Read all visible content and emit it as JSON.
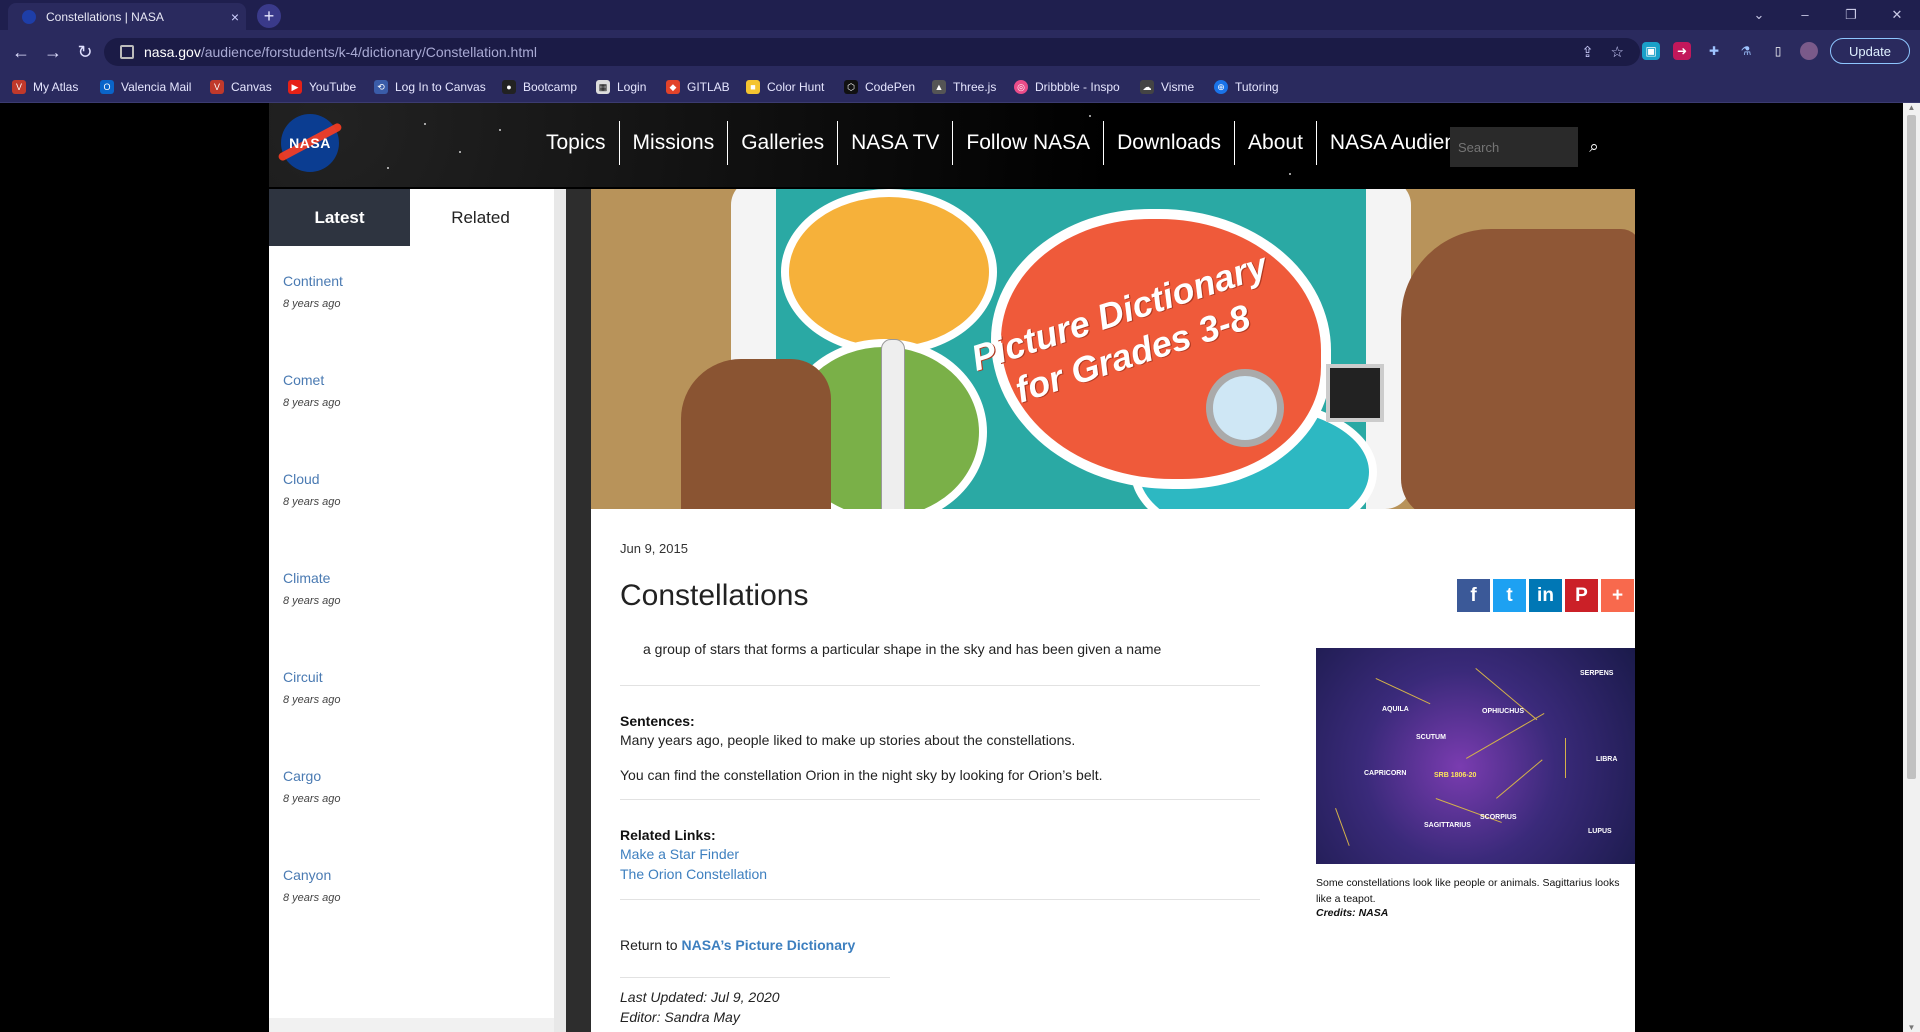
{
  "browser": {
    "tab_title": "Constellations | NASA",
    "tab_close": "×",
    "new_tab": "+",
    "url_host": "nasa.gov",
    "url_path": "/audience/forstudents/k-4/dictionary/Constellation.html",
    "update_label": "Update",
    "bookmarks": [
      {
        "label": "My Atlas",
        "icon": "atlas-icon",
        "color": "#c0392b"
      },
      {
        "label": "Valencia Mail",
        "icon": "outlook-icon",
        "color": "#0a64c9"
      },
      {
        "label": "Canvas",
        "icon": "canvas-icon",
        "color": "#c0392b"
      },
      {
        "label": "YouTube",
        "icon": "youtube-icon",
        "color": "#e62117"
      },
      {
        "label": "Log In to Canvas",
        "icon": "canvas-login-icon",
        "color": "#3a5ca8"
      },
      {
        "label": "Bootcamp",
        "icon": "bootcamp-icon",
        "color": "#222222"
      },
      {
        "label": "Login",
        "icon": "login-icon",
        "color": "#dddddd"
      },
      {
        "label": "GITLAB",
        "icon": "gitlab-icon",
        "color": "#e2432a"
      },
      {
        "label": "Color Hunt",
        "icon": "colorhunt-icon",
        "color": "#f4c430"
      },
      {
        "label": "CodePen",
        "icon": "codepen-icon",
        "color": "#111111"
      },
      {
        "label": "Three.js",
        "icon": "threejs-icon",
        "color": "#555555"
      },
      {
        "label": "Dribbble - Inspo",
        "icon": "dribbble-icon",
        "color": "#ea4c89"
      },
      {
        "label": "Visme",
        "icon": "visme-icon",
        "color": "#444444"
      },
      {
        "label": "Tutoring",
        "icon": "tutoring-icon",
        "color": "#1a73e8"
      }
    ]
  },
  "nasa": {
    "logo_text": "NASA",
    "nav": [
      "Topics",
      "Missions",
      "Galleries",
      "NASA TV",
      "Follow NASA",
      "Downloads",
      "About",
      "NASA Audiences"
    ],
    "search_placeholder": "Search"
  },
  "sidebar": {
    "tabs": {
      "latest": "Latest",
      "related": "Related"
    },
    "items": [
      {
        "title": "Continent",
        "date": "8 years ago"
      },
      {
        "title": "Comet",
        "date": "8 years ago"
      },
      {
        "title": "Cloud",
        "date": "8 years ago"
      },
      {
        "title": "Climate",
        "date": "8 years ago"
      },
      {
        "title": "Circuit",
        "date": "8 years ago"
      },
      {
        "title": "Cargo",
        "date": "8 years ago"
      },
      {
        "title": "Canyon",
        "date": "8 years ago"
      }
    ]
  },
  "hero": {
    "title": "Picture Dictionary for Grades 3-8"
  },
  "article": {
    "date": "Jun 9, 2015",
    "title": "Constellations",
    "share": [
      "f",
      "t",
      "in",
      "P",
      "+"
    ],
    "definition": "a group of stars that forms a particular shape in the sky and has been given a name",
    "sentences_label": "Sentences:",
    "sentence1": "Many years ago, people liked to make up stories about the constellations.",
    "sentence2": "You can find the constellation Orion in the night sky by looking for Orion’s belt.",
    "related_label": "Related Links:",
    "link1": "Make a Star Finder",
    "link2": "The Orion Constellation",
    "return_prefix": "Return to ",
    "return_link": "NASA’s Picture Dictionary",
    "last_updated": "Last Updated: Jul 9, 2020",
    "editor": "Editor: Sandra May"
  },
  "figure": {
    "labels": [
      "SERPENS",
      "AQUILA",
      "OPHIUCHUS",
      "SCUTUM",
      "CAPRICORN",
      "SRB 1806-20",
      "LIBRA",
      "SAGITTARIUS",
      "SCORPIUS",
      "LUPUS"
    ],
    "caption": "Some constellations look like people or animals. Sagittarius looks like a teapot.",
    "credit": "Credits: NASA"
  }
}
